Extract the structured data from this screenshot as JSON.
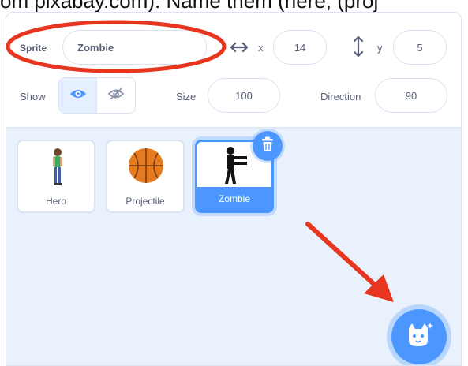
{
  "caption": "om pixabay.com). Name them (here, (proj",
  "sprite_info": {
    "sprite_label": "Sprite",
    "sprite_name": "Zombie",
    "x_label": "x",
    "x_value": "14",
    "y_label": "y",
    "y_value": "5",
    "show_label": "Show",
    "size_label": "Size",
    "size_value": "100",
    "direction_label": "Direction",
    "direction_value": "90"
  },
  "sprites": [
    {
      "name": "Hero"
    },
    {
      "name": "Projectile"
    },
    {
      "name": "Zombie"
    }
  ],
  "colors": {
    "accent": "#4c97ff",
    "annotation": "#e8351f",
    "pane_bg": "#e9f1fc"
  },
  "icons": {
    "x_axis": "horizontal-arrows-icon",
    "y_axis": "vertical-arrows-icon",
    "show_visible": "eye-icon",
    "show_hidden": "eye-slash-icon",
    "delete": "trash-icon",
    "choose_sprite": "cat-icon"
  }
}
